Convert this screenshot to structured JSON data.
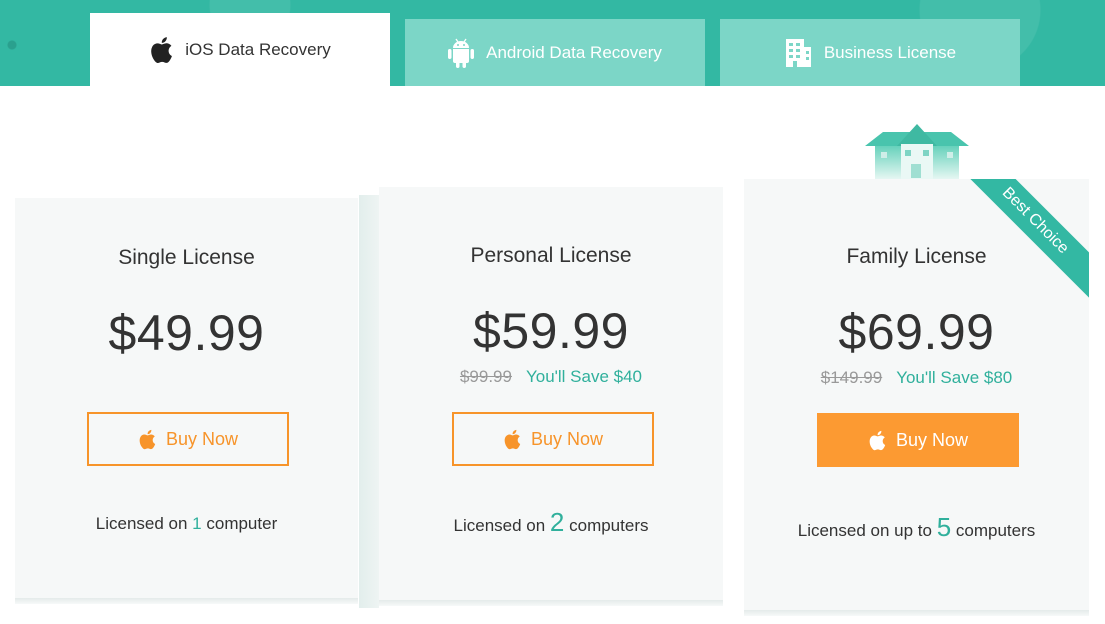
{
  "tabs": [
    {
      "label": "iOS Data Recovery",
      "icon": "apple-icon",
      "active": true
    },
    {
      "label": "Android Data Recovery",
      "icon": "android-icon",
      "active": false
    },
    {
      "label": "Business License",
      "icon": "building-icon",
      "active": false
    }
  ],
  "plans": [
    {
      "title": "Single License",
      "price": "$49.99",
      "button": "Buy Now",
      "license_prefix": "Licensed on ",
      "license_count": "1",
      "license_suffix": " computer"
    },
    {
      "title": "Personal License",
      "price": "$59.99",
      "old_price": "$99.99",
      "save": "You'll Save $40",
      "button": "Buy Now",
      "license_prefix": "Licensed on ",
      "license_count": "2",
      "license_suffix": " computers"
    },
    {
      "title": "Family License",
      "price": "$69.99",
      "old_price": "$149.99",
      "save": "You'll Save $80",
      "button": "Buy Now",
      "license_prefix": "Licensed on up to ",
      "license_count": "5",
      "license_suffix": " computers",
      "ribbon": "Best Choice"
    }
  ],
  "colors": {
    "brand_teal": "#33b8a3",
    "tab_inactive": "#7cd6c7",
    "accent_orange": "#fc9a32",
    "save_green": "#30b09c"
  }
}
